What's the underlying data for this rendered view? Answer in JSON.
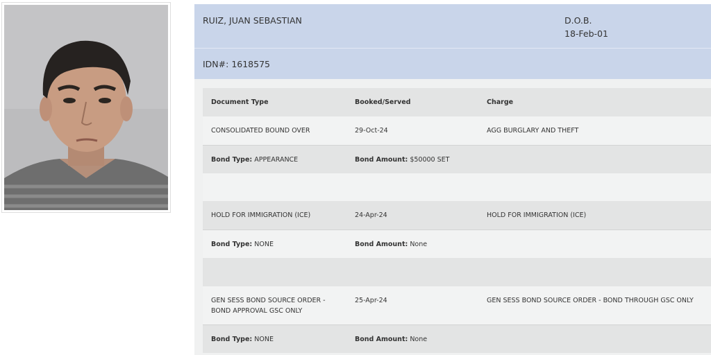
{
  "inmate": {
    "name": "RUIZ, JUAN SEBASTIAN",
    "dob_label": "D.O.B.",
    "dob": "18-Feb-01",
    "idn": "IDN#: 1618575"
  },
  "table": {
    "headers": [
      "Document Type",
      "Booked/Served",
      "Charge"
    ],
    "bond_type_label": "Bond Type:",
    "bond_amount_label": "Bond Amount:",
    "records": [
      {
        "document_type": "CONSOLIDATED BOUND OVER",
        "booked_served": "29-Oct-24",
        "charge": "AGG BURGLARY AND THEFT",
        "bond_type": "APPEARANCE",
        "bond_amount": "$50000 SET"
      },
      {
        "document_type": "HOLD FOR IMMIGRATION (ICE)",
        "booked_served": "24-Apr-24",
        "charge": "HOLD FOR IMMIGRATION (ICE)",
        "bond_type": "NONE",
        "bond_amount": "None"
      },
      {
        "document_type_line1": "GEN SESS BOND SOURCE ORDER -",
        "document_type_line2": "BOND APPROVAL GSC ONLY",
        "booked_served": "25-Apr-24",
        "charge": "GEN SESS BOND SOURCE ORDER - BOND THROUGH GSC ONLY",
        "bond_type": "NONE",
        "bond_amount": "None"
      }
    ]
  },
  "colors": {
    "header_background": "#c9d5ea",
    "panel_background": "#f0f1f1",
    "row_dark": "#e3e4e4"
  }
}
